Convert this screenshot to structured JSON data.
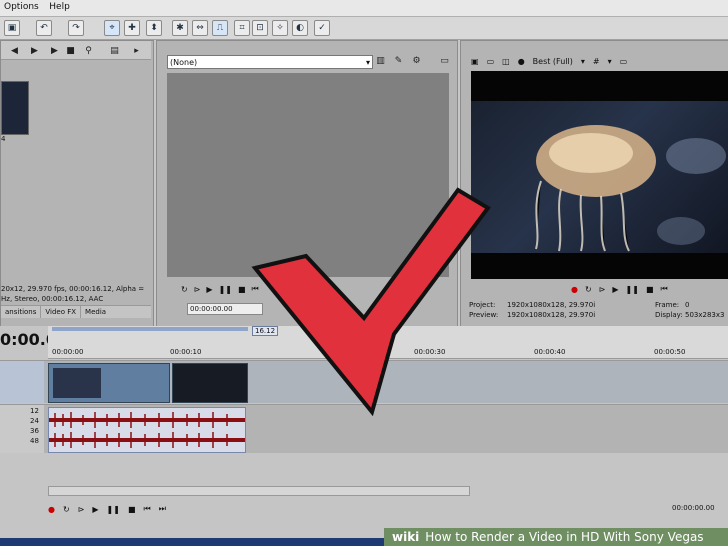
{
  "menu": [
    "Options",
    "Help"
  ],
  "media_panel": {
    "thumb_label": "4",
    "info": [
      "20x12, 29.970 fps, 00:00:16.12, Alpha =",
      "Hz, Stereo, 00:00:16.12, AAC"
    ],
    "tabs": [
      "ansitions",
      "Video FX",
      "Media"
    ]
  },
  "trimmer": {
    "preset": "(None)",
    "timecode": "00:00:00.00"
  },
  "preview": {
    "quality": "Best (Full)",
    "project_label": "Project:",
    "project_value": "1920x1080x128, 29.970i",
    "preview_label": "Preview:",
    "preview_value": "1920x1080x128, 29.970i",
    "frame_label": "Frame:",
    "frame_value": "0",
    "display_label": "Display:",
    "display_value": "503x283x3"
  },
  "timeline": {
    "current_time": "0:00.00",
    "end_marker": "16.12",
    "ruler_ticks": [
      "00:00:00",
      "00:00:10",
      "00:00:30",
      "00:00:40",
      "00:00:50"
    ],
    "track_numbers": [
      "12",
      "24",
      "36",
      "48"
    ],
    "bottom_timecode": "00:00:00.00"
  },
  "watermark": {
    "brand": "wiki",
    "text": "How to Render a Video in HD With Sony Vegas"
  },
  "colors": {
    "arrow": "#e0313d",
    "arrow_outline": "#111111",
    "watermark_bg": "#6f8f62"
  },
  "icons": {
    "play": "play-icon",
    "stop": "stop-icon",
    "loop": "loop-icon",
    "record": "record-icon"
  }
}
